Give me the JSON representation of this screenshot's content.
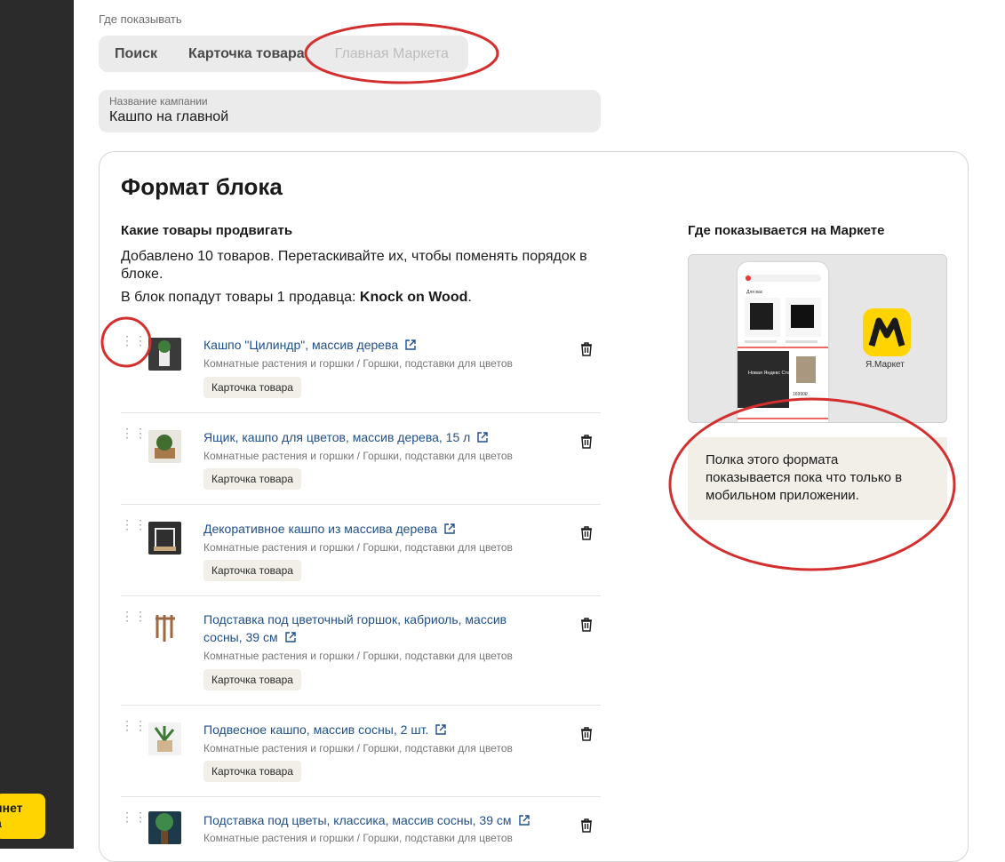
{
  "sidebar": {
    "cabinet_button_label": "инет\nа"
  },
  "placement": {
    "label": "Где показывать",
    "options": [
      {
        "label": "Поиск",
        "state": "normal"
      },
      {
        "label": "Карточка товара",
        "state": "normal"
      },
      {
        "label": "Главная Маркета",
        "state": "disabled"
      }
    ]
  },
  "campaign": {
    "label": "Название кампании",
    "value": "Кашпо на главной"
  },
  "format": {
    "title": "Формат блока",
    "products_heading": "Какие товары продвигать",
    "added_text": "Добавлено 10 товаров. Перетаскивайте их, чтобы поменять порядок в блоке.",
    "seller_text_prefix": "В блок попадут товары 1 продавца: ",
    "seller_name": "Knock on Wood",
    "seller_text_suffix": ".",
    "products": [
      {
        "title": "Кашпо \"Цилиндр\", массив дерева",
        "category": "Комнатные растения и горшки / Горшки, подставки для цветов",
        "badge": "Карточка товара"
      },
      {
        "title": "Ящик, кашпо для цветов, массив дерева, 15 л",
        "category": "Комнатные растения и горшки / Горшки, подставки для цветов",
        "badge": "Карточка товара"
      },
      {
        "title": "Декоративное кашпо из массива дерева",
        "category": "Комнатные растения и горшки / Горшки, подставки для цветов",
        "badge": "Карточка товара"
      },
      {
        "title": "Подставка под цветочный горшок, кабриоль, массив сосны, 39 см",
        "category": "Комнатные растения и горшки / Горшки, подставки для цветов",
        "badge": "Карточка товара"
      },
      {
        "title": "Подвесное кашпо, массив сосны, 2 шт.",
        "category": "Комнатные растения и горшки / Горшки, подставки для цветов",
        "badge": "Карточка товара"
      },
      {
        "title": "Подставка под цветы, классика, массив сосны, 39 см",
        "category": "Комнатные растения и горшки / Горшки, подставки для цветов",
        "badge": ""
      }
    ],
    "preview_heading": "Где показывается на Маркете",
    "preview_phone_text": {
      "section": "Для вас",
      "promo_title": "Новая Яндекс Станция",
      "price": "16990₽"
    },
    "preview_logo_text": "Я.Маркет",
    "info_text": "Полка этого формата показывается пока что только в мобильном приложении."
  },
  "icons": {
    "external": "external-link-icon",
    "trash": "trash-icon",
    "drag": "drag-handle-icon"
  },
  "colors": {
    "link": "#1f4f8a",
    "badge_bg": "#f2efe9",
    "annotation": "#d32f2f",
    "brand_yellow": "#ffd400"
  }
}
